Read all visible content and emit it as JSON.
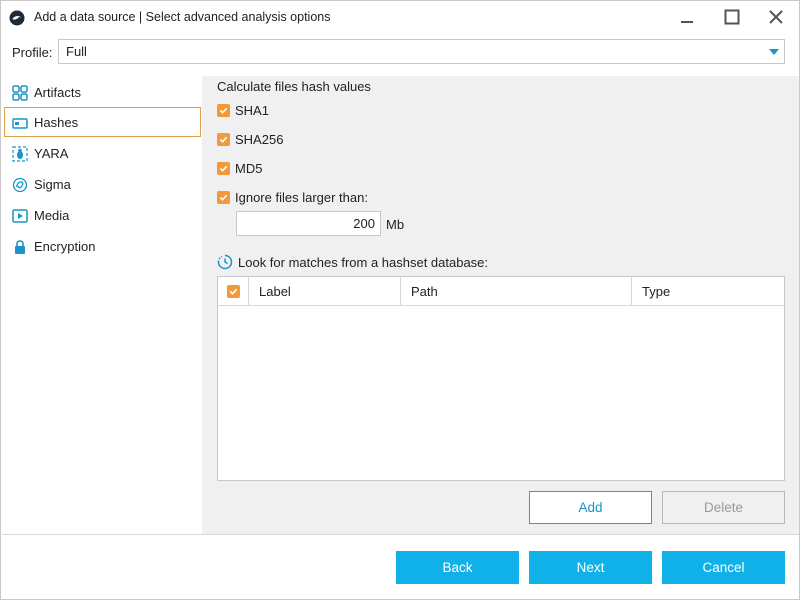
{
  "window": {
    "title": "Add a data source | Select advanced analysis options",
    "controls": {
      "minimize": "minimize-icon",
      "maximize": "maximize-icon",
      "close": "close-icon"
    }
  },
  "profile": {
    "label": "Profile:",
    "value": "Full"
  },
  "nav": {
    "items": [
      {
        "label": "Artifacts",
        "icon": "artifacts-grid-icon",
        "active": false
      },
      {
        "label": "Hashes",
        "icon": "hash-card-icon",
        "active": true
      },
      {
        "label": "YARA",
        "icon": "yara-bug-icon",
        "active": false
      },
      {
        "label": "Sigma",
        "icon": "sigma-fingerprint-icon",
        "active": false
      },
      {
        "label": "Media",
        "icon": "media-play-icon",
        "active": false
      },
      {
        "label": "Encryption",
        "icon": "lock-icon",
        "active": false
      }
    ]
  },
  "hashes": {
    "section_title": "Calculate files hash values",
    "options": [
      {
        "label": "SHA1",
        "checked": true
      },
      {
        "label": "SHA256",
        "checked": true
      },
      {
        "label": "MD5",
        "checked": true
      },
      {
        "label": "Ignore files larger than:",
        "checked": true
      }
    ],
    "size_limit": "200",
    "size_unit": "Mb",
    "hashset_title": "Look for matches from a hashset database:",
    "table": {
      "columns": [
        "Label",
        "Path",
        "Type"
      ],
      "header_checked": true,
      "rows": []
    },
    "add_label": "Add",
    "delete_label": "Delete"
  },
  "footer": {
    "back_label": "Back",
    "next_label": "Next",
    "cancel_label": "Cancel"
  },
  "colors": {
    "accent": "#10b0e8",
    "checkbox": "#f29a3a",
    "active_border": "#e0a04a"
  }
}
